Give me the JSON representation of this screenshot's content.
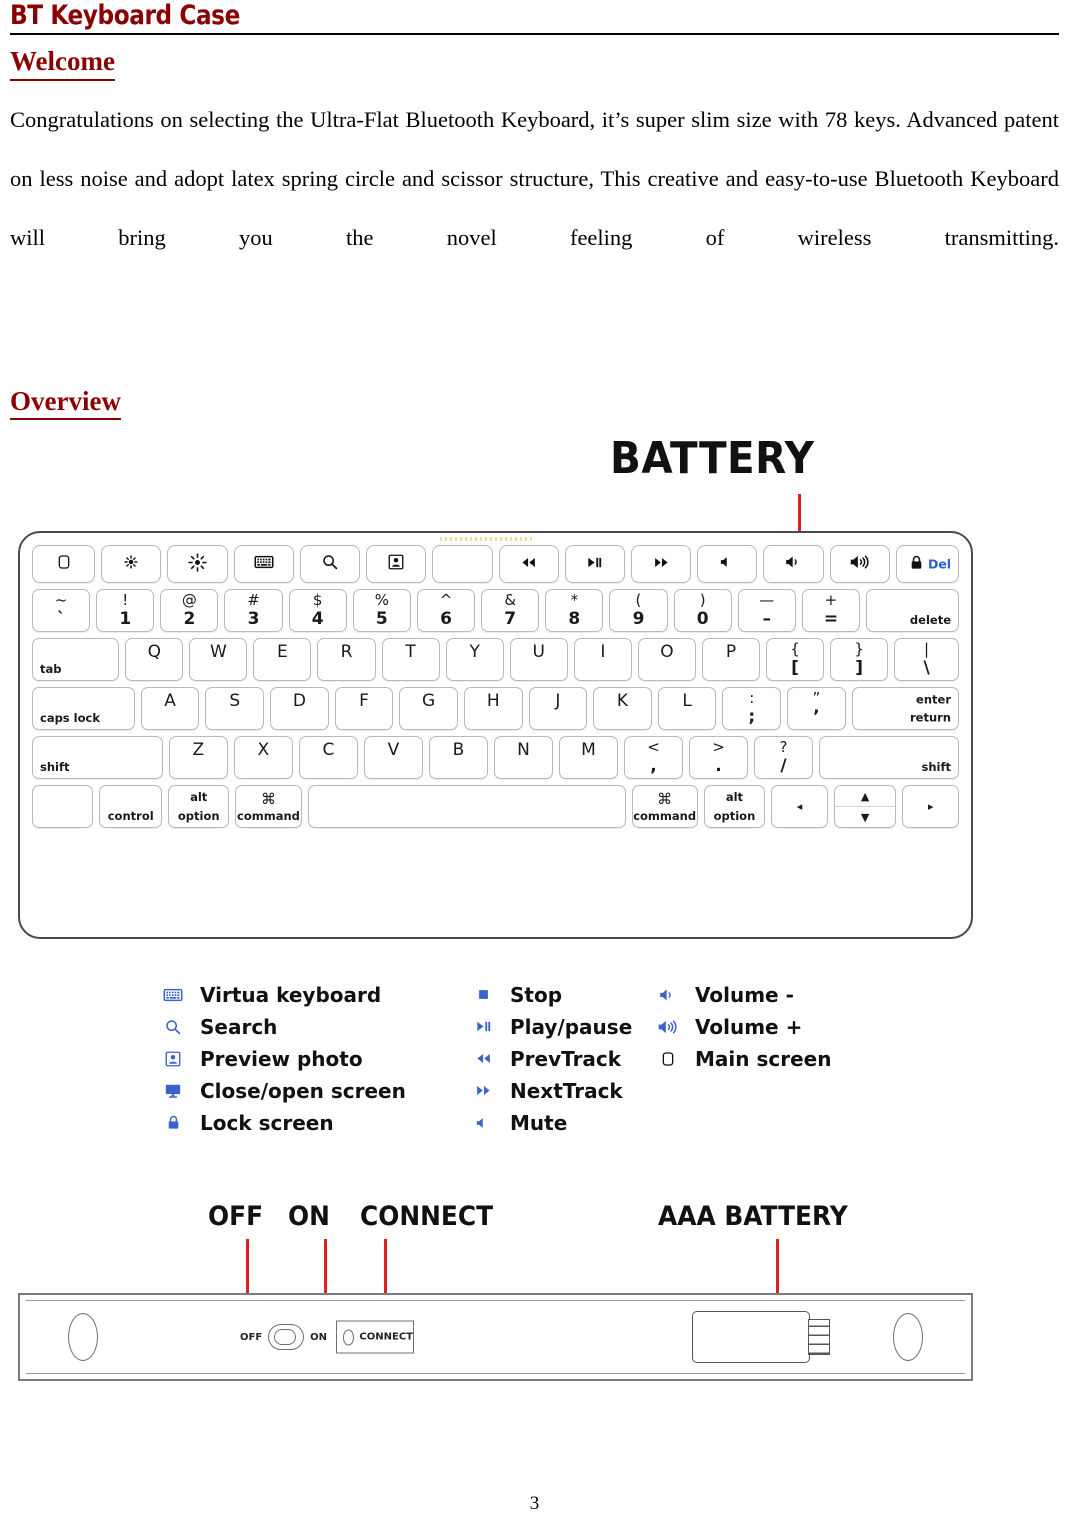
{
  "document": {
    "header_title": "BT Keyboard Case",
    "page_number": "3",
    "accent_color": "#8B0000",
    "callout_color": "#e02020",
    "legend_icon_color": "#3b63c9"
  },
  "welcome": {
    "heading": "Welcome",
    "paragraph": "Congratulations on selecting the Ultra-Flat Bluetooth Keyboard, it’s super slim size with 78 keys. Advanced patent on less noise and adopt latex spring circle and scissor structure, This creative and easy-to-use Bluetooth Keyboard will bring you the novel feeling of wireless transmitting."
  },
  "overview": {
    "heading": "Overview",
    "battery_callout": "BATTERY",
    "keyboard": {
      "function_row": [
        {
          "name": "main-screen-key",
          "icon": "rounded-square-icon",
          "glyph": "▢"
        },
        {
          "name": "brightness-down-key",
          "icon": "brightness-down-icon",
          "glyph": "✳"
        },
        {
          "name": "brightness-up-key",
          "icon": "brightness-up-icon",
          "glyph": "✺"
        },
        {
          "name": "virtual-keyboard-key",
          "icon": "keyboard-icon",
          "glyph": "⌨"
        },
        {
          "name": "search-key",
          "icon": "search-icon",
          "glyph": "⌕"
        },
        {
          "name": "preview-photo-key",
          "icon": "preview-photo-icon",
          "glyph": "⧉"
        },
        {
          "name": "blank-key",
          "icon": "",
          "glyph": ""
        },
        {
          "name": "prev-track-key",
          "icon": "prev-track-icon",
          "glyph": "◀◀"
        },
        {
          "name": "play-pause-key",
          "icon": "play-pause-icon",
          "glyph": "▶‖"
        },
        {
          "name": "next-track-key",
          "icon": "next-track-icon",
          "glyph": "▶▶"
        },
        {
          "name": "mute-key",
          "icon": "mute-icon",
          "glyph": "◂"
        },
        {
          "name": "volume-down-key",
          "icon": "volume-down-icon",
          "glyph": "◂)"
        },
        {
          "name": "volume-up-key",
          "icon": "volume-up-icon",
          "glyph": "◂))"
        },
        {
          "name": "lock-del-key",
          "icon": "lock-icon",
          "glyph": "🔒",
          "sublabel": "Del"
        }
      ],
      "number_row": [
        {
          "upper": "~",
          "lower": "ˋ"
        },
        {
          "upper": "!",
          "lower": "1"
        },
        {
          "upper": "@",
          "lower": "2"
        },
        {
          "upper": "#",
          "lower": "3"
        },
        {
          "upper": "$",
          "lower": "4"
        },
        {
          "upper": "%",
          "lower": "5"
        },
        {
          "upper": "^",
          "lower": "6"
        },
        {
          "upper": "&",
          "lower": "7"
        },
        {
          "upper": "*",
          "lower": "8"
        },
        {
          "upper": "(",
          "lower": "9"
        },
        {
          "upper": ")",
          "lower": "0"
        },
        {
          "upper": "—",
          "lower": "–"
        },
        {
          "upper": "+",
          "lower": "="
        },
        {
          "label": "delete"
        }
      ],
      "qwerty_row": [
        {
          "label": "tab"
        },
        {
          "glyph": "Q"
        },
        {
          "glyph": "W"
        },
        {
          "glyph": "E"
        },
        {
          "glyph": "R"
        },
        {
          "glyph": "T"
        },
        {
          "glyph": "Y"
        },
        {
          "glyph": "U"
        },
        {
          "glyph": "I"
        },
        {
          "glyph": "O"
        },
        {
          "glyph": "P"
        },
        {
          "upper": "{",
          "lower": "["
        },
        {
          "upper": "}",
          "lower": "]"
        },
        {
          "upper": "|",
          "lower": "\\"
        }
      ],
      "home_row": [
        {
          "label": "caps lock"
        },
        {
          "glyph": "A"
        },
        {
          "glyph": "S"
        },
        {
          "glyph": "D"
        },
        {
          "glyph": "F"
        },
        {
          "glyph": "G"
        },
        {
          "glyph": "H"
        },
        {
          "glyph": "J"
        },
        {
          "glyph": "K"
        },
        {
          "glyph": "L"
        },
        {
          "upper": ":",
          "lower": ";"
        },
        {
          "upper": "”",
          "lower": "’"
        },
        {
          "label_top": "enter",
          "label_bottom": "return"
        }
      ],
      "shift_row": [
        {
          "label": "shift"
        },
        {
          "glyph": "Z"
        },
        {
          "glyph": "X"
        },
        {
          "glyph": "C"
        },
        {
          "glyph": "V"
        },
        {
          "glyph": "B"
        },
        {
          "glyph": "N"
        },
        {
          "glyph": "M"
        },
        {
          "upper": "<",
          "lower": ","
        },
        {
          "upper": ">",
          "lower": "."
        },
        {
          "upper": "?",
          "lower": "/"
        },
        {
          "label": "shift"
        }
      ],
      "bottom_row": [
        {
          "label": ""
        },
        {
          "label": "control"
        },
        {
          "top": "alt",
          "bottom": "option"
        },
        {
          "top": "⌘",
          "bottom": "command"
        },
        {
          "label": "",
          "name": "spacebar"
        },
        {
          "top": "⌘",
          "bottom": "command"
        },
        {
          "top": "alt",
          "bottom": "option"
        },
        {
          "glyph": "◂",
          "name": "arrow-left-key"
        },
        {
          "up": "▲",
          "down": "▼",
          "name": "arrow-up-down-key"
        },
        {
          "glyph": "▸",
          "name": "arrow-right-key"
        }
      ]
    },
    "legend": {
      "column1": [
        {
          "icon": "keyboard-icon",
          "glyph": "⌨",
          "label": "Virtua keyboard"
        },
        {
          "icon": "search-icon",
          "glyph": "⌕",
          "label": "Search"
        },
        {
          "icon": "preview-photo-icon",
          "glyph": "⧉",
          "label": "Preview photo"
        },
        {
          "icon": "monitor-icon",
          "glyph": "▣",
          "label": "Close/open screen"
        },
        {
          "icon": "lock-icon",
          "glyph": "🔒",
          "label": "Lock screen"
        }
      ],
      "column2": [
        {
          "icon": "stop-icon",
          "glyph": "■",
          "label": "Stop"
        },
        {
          "icon": "play-pause-icon",
          "glyph": "▶‖",
          "label": "Play/pause"
        },
        {
          "icon": "prev-track-icon",
          "glyph": "◀◀",
          "label": "PrevTrack"
        },
        {
          "icon": "next-track-icon",
          "glyph": "▶▶",
          "label": "NextTrack"
        },
        {
          "icon": "mute-icon",
          "glyph": "◂",
          "label": "Mute"
        }
      ],
      "column3": [
        {
          "icon": "volume-down-icon",
          "glyph": "◂)",
          "label": "Volume -"
        },
        {
          "icon": "volume-up-icon",
          "glyph": "◂))",
          "label": "Volume +"
        },
        {
          "icon": "rounded-square-icon",
          "glyph": "▢",
          "label": "Main screen"
        }
      ]
    },
    "edge_view": {
      "labels": {
        "off": "OFF",
        "on": "ON",
        "connect": "CONNECT",
        "battery": "AAA BATTERY"
      },
      "device_marks": {
        "off": "OFF",
        "on": "ON",
        "connect": "CONNECT"
      }
    }
  }
}
